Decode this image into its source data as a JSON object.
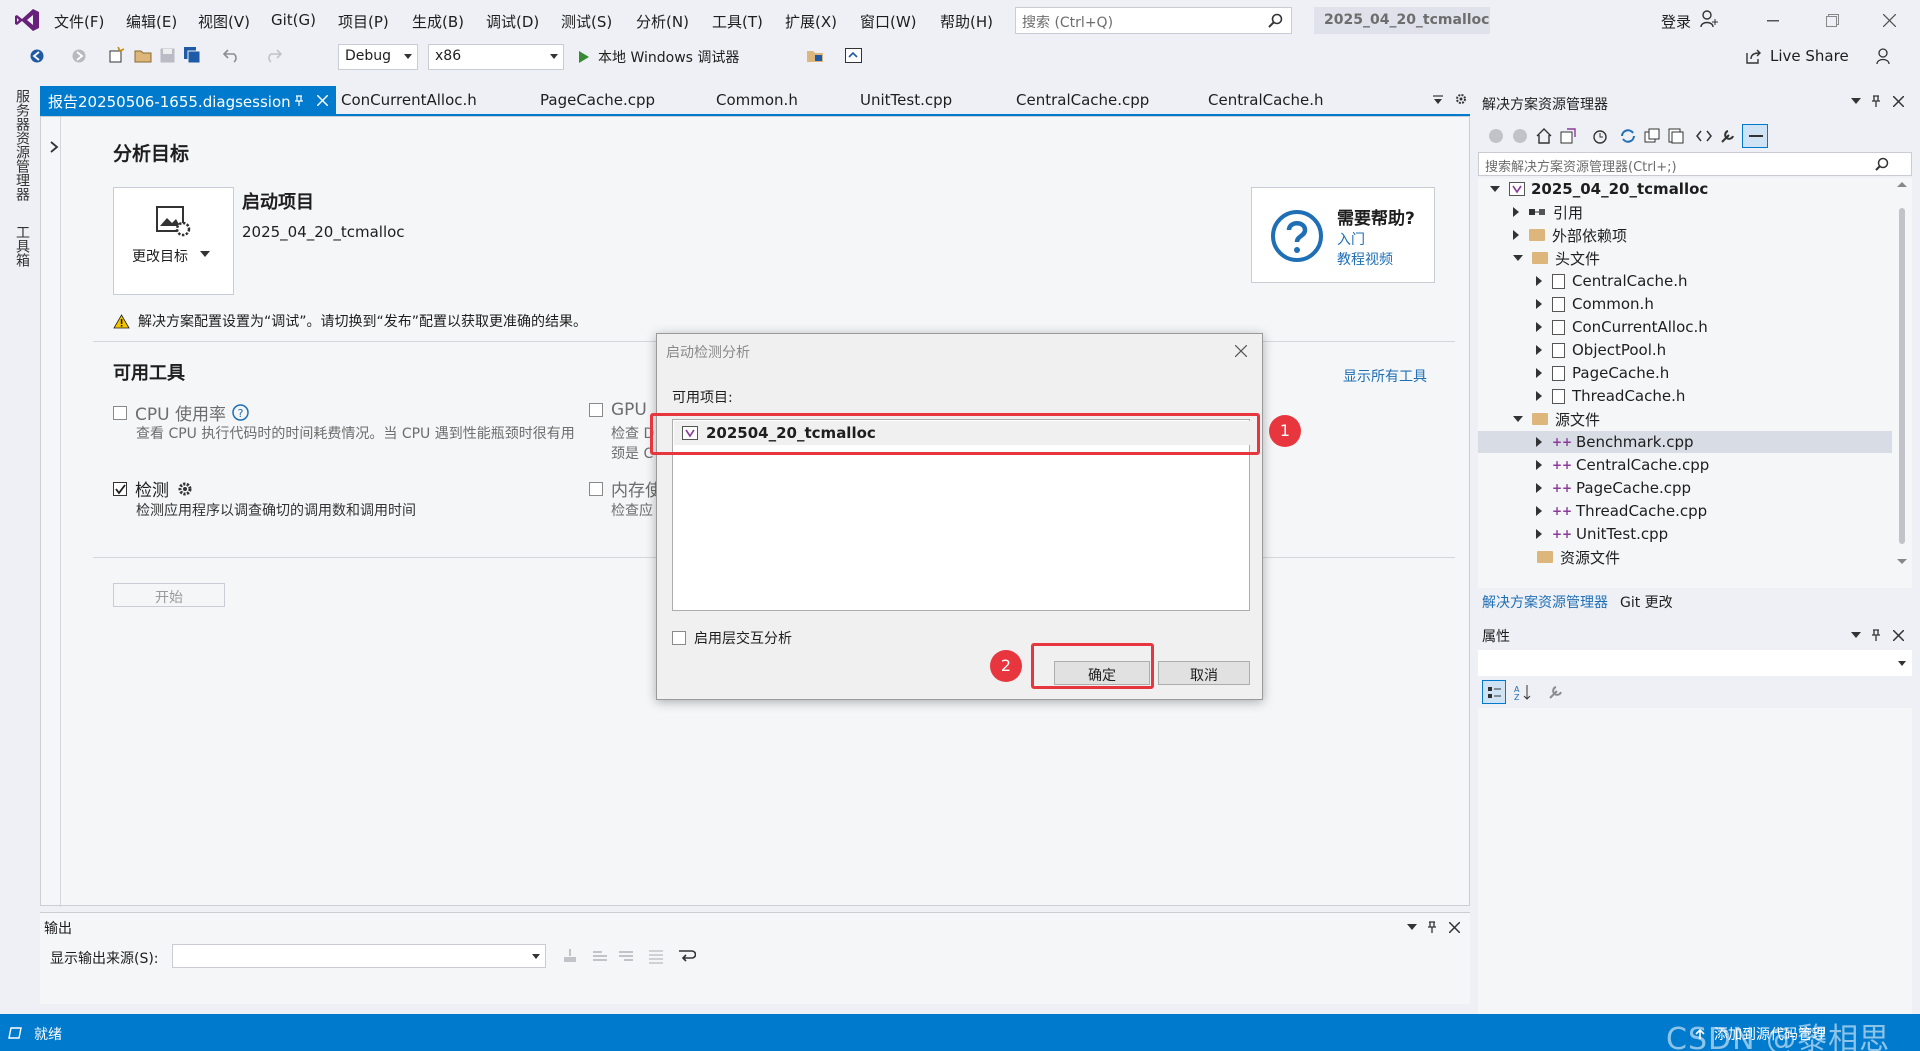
{
  "menu": {
    "items": [
      "文件(F)",
      "编辑(E)",
      "视图(V)",
      "Git(G)",
      "项目(P)",
      "生成(B)",
      "调试(D)",
      "测试(S)",
      "分析(N)",
      "工具(T)",
      "扩展(X)",
      "窗口(W)",
      "帮助(H)"
    ],
    "search_placeholder": "搜索 (Ctrl+Q)",
    "project_name": "2025_04_20_tcmalloc",
    "login": "登录"
  },
  "toolbar": {
    "config": "Debug",
    "platform": "x86",
    "run_label": "本地 Windows 调试器",
    "live_share": "Live Share"
  },
  "left_rail": {
    "item1": "服务器资源管理器",
    "item2": "工具箱"
  },
  "tabs": [
    "报告20250506-1655.diagsession",
    "ConCurrentAlloc.h",
    "PageCache.cpp",
    "Common.h",
    "UnitTest.cpp",
    "CentralCache.cpp",
    "CentralCache.h"
  ],
  "doc": {
    "target_heading": "分析目标",
    "change_target": "更改目标",
    "startup_title": "启动项目",
    "startup_name": "2025_04_20_tcmalloc",
    "help_title": "需要帮助?",
    "help_link1": "入门",
    "help_link2": "教程视频",
    "warning": "解决方案配置设置为“调试”。请切换到“发布”配置以获取更准确的结果。",
    "tools_heading": "可用工具",
    "show_all": "显示所有工具",
    "cpu_label": "CPU 使用率",
    "cpu_desc": "查看 CPU 执行代码时的时间耗费情况。当 CPU 遇到性能瓶颈时很有用",
    "gpu_label": "GPU",
    "gpu_desc1": "检查 D",
    "gpu_desc2": "颈是 C",
    "instr_label": "检测",
    "instr_desc": "检测应用程序以调查确切的调用数和调用时间",
    "mem_label": "内存使",
    "mem_desc": "检查应",
    "start": "开始"
  },
  "dialog": {
    "title": "启动检测分析",
    "list_label": "可用项目:",
    "project": "202504_20_tcmalloc",
    "checkbox": "启用层交互分析",
    "ok": "确定",
    "cancel": "取消",
    "badge1": "1",
    "badge2": "2"
  },
  "solution": {
    "title": "解决方案资源管理器",
    "search": "搜索解决方案资源管理器(Ctrl+;)",
    "root": "2025_04_20_tcmalloc",
    "refs": "引用",
    "ext": "外部依赖项",
    "headers": "头文件",
    "h_files": [
      "CentralCache.h",
      "Common.h",
      "ConCurrentAlloc.h",
      "ObjectPool.h",
      "PageCache.h",
      "ThreadCache.h"
    ],
    "src": "源文件",
    "cpp_files": [
      "Benchmark.cpp",
      "CentralCache.cpp",
      "PageCache.cpp",
      "ThreadCache.cpp",
      "UnitTest.cpp"
    ],
    "res": "资源文件",
    "tab1": "解决方案资源管理器",
    "tab2": "Git 更改"
  },
  "properties": {
    "title": "属性"
  },
  "output": {
    "title": "输出",
    "source_label": "显示输出来源(S):"
  },
  "status": {
    "text": "就绪",
    "right": "添加到源代码管理",
    "watermark": "CSDN @黎相思"
  },
  "colors": {
    "accent": "#007acc",
    "highlight": "#e8363f"
  }
}
